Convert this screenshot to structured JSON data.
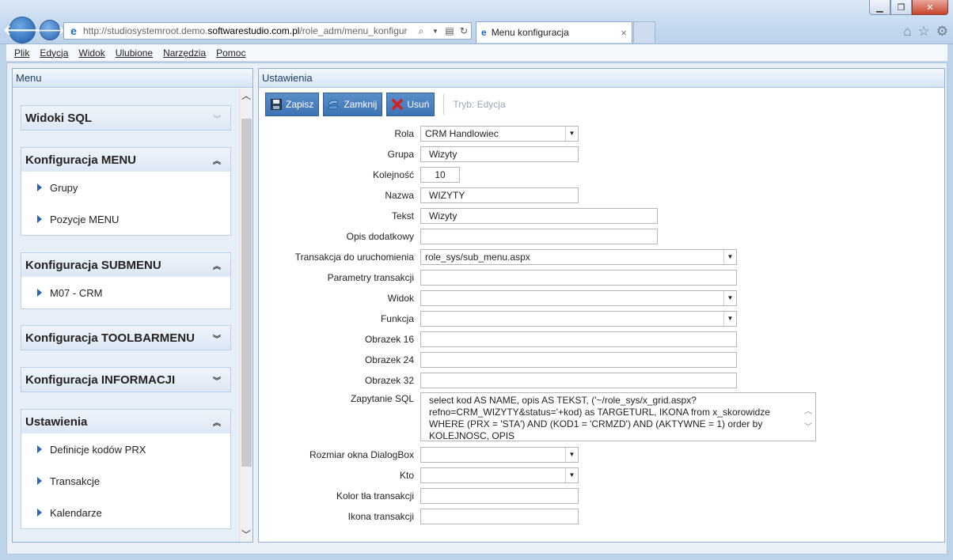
{
  "browser": {
    "url_prefix": "http://studiosystemroot.demo.",
    "url_domain": "softwarestudio.com.pl",
    "url_path": "/role_adm/menu_konfigur",
    "tab_title": "Menu konfiguracja",
    "tab_close": "×"
  },
  "menubar": [
    "Plik",
    "Edycja",
    "Widok",
    "Ulubione",
    "Narzędzia",
    "Pomoc"
  ],
  "left_panel": {
    "title": "Menu",
    "sections": [
      {
        "title": "Widoki SQL",
        "expanded": false,
        "items": []
      },
      {
        "title": "Konfiguracja MENU",
        "expanded": true,
        "items": [
          "Grupy",
          "Pozycje MENU"
        ]
      },
      {
        "title": "Konfiguracja SUBMENU",
        "expanded": true,
        "items": [
          "M07 - CRM"
        ]
      },
      {
        "title": "Konfiguracja TOOLBARMENU",
        "expanded": false,
        "items": []
      },
      {
        "title": "Konfiguracja INFORMACJI",
        "expanded": false,
        "items": []
      },
      {
        "title": "Ustawienia",
        "expanded": true,
        "items": [
          "Definicje kodów PRX",
          "Transakcje",
          "Kalendarze"
        ]
      }
    ]
  },
  "right_panel": {
    "title": "Ustawienia",
    "toolbar": {
      "save": "Zapisz",
      "close": "Zamknij",
      "delete": "Usuń",
      "mode": "Tryb: Edycja"
    },
    "form": {
      "rola": {
        "label": "Rola",
        "value": "CRM Handlowiec"
      },
      "grupa": {
        "label": "Grupa",
        "value": "Wizyty"
      },
      "kolejnosc": {
        "label": "Kolejność",
        "value": "10"
      },
      "nazwa": {
        "label": "Nazwa",
        "value": "WIZYTY"
      },
      "tekst": {
        "label": "Tekst",
        "value": "Wizyty"
      },
      "opis": {
        "label": "Opis dodatkowy",
        "value": ""
      },
      "transakcja": {
        "label": "Transakcja do uruchomienia",
        "value": "role_sys/sub_menu.aspx"
      },
      "parametry": {
        "label": "Parametry transakcji",
        "value": ""
      },
      "widok": {
        "label": "Widok",
        "value": ""
      },
      "funkcja": {
        "label": "Funkcja",
        "value": ""
      },
      "obrazek16": {
        "label": "Obrazek 16",
        "value": ""
      },
      "obrazek24": {
        "label": "Obrazek 24",
        "value": ""
      },
      "obrazek32": {
        "label": "Obrazek 32",
        "value": ""
      },
      "zapytanie": {
        "label": "Zapytanie SQL",
        "value": "select kod AS NAME, opis AS TEKST, ('~/role_sys/x_grid.aspx?refno=CRM_WIZYTY&status='+kod) as TARGETURL, IKONA  from x_skorowidze WHERE (PRX = 'STA') AND (KOD1 = 'CRMZD') AND (AKTYWNE = 1) order by KOLEJNOSC, OPIS"
      },
      "rozmiar": {
        "label": "Rozmiar okna DialogBox",
        "value": ""
      },
      "kto": {
        "label": "Kto",
        "value": ""
      },
      "kolor": {
        "label": "Kolor tła transakcji",
        "value": ""
      },
      "ikona": {
        "label": "Ikona transakcji",
        "value": ""
      }
    }
  }
}
